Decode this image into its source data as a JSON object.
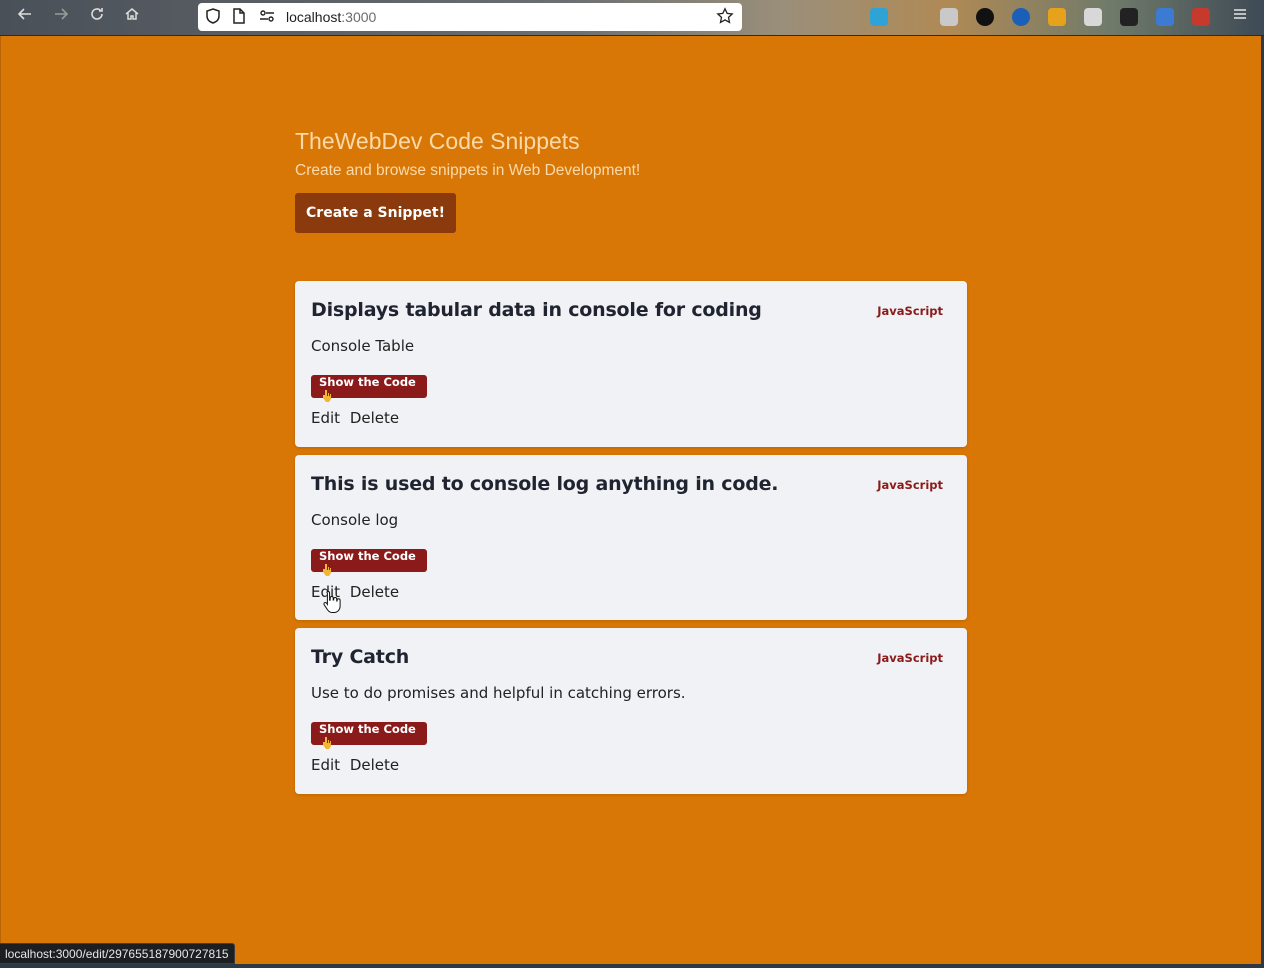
{
  "browser": {
    "url_host": "localhost",
    "url_port": ":3000",
    "status_url": "localhost:3000/edit/297655187900727815"
  },
  "page": {
    "title": "TheWebDev Code Snippets",
    "subtitle": "Create and browse snippets in Web Development!",
    "create_button": "Create a Snippet!"
  },
  "snippets": [
    {
      "title": "Displays tabular data in console for coding",
      "language": "JavaScript",
      "description": "Console Table",
      "show_button": "Show the Code",
      "edit": "Edit",
      "delete": "Delete"
    },
    {
      "title": "This is used to console log anything in code.",
      "language": "JavaScript",
      "description": "Console log",
      "show_button": "Show the Code",
      "edit": "Edit",
      "delete": "Delete"
    },
    {
      "title": "Try Catch",
      "language": "JavaScript",
      "description": "Use to do promises and helpful in catching errors.",
      "show_button": "Show the Code",
      "edit": "Edit",
      "delete": "Delete"
    }
  ],
  "colors": {
    "background": "#d97706",
    "primary_button": "#8a3a0c",
    "accent": "#8b1a1a",
    "card": "#f0f2f5"
  },
  "icons": [
    "back-icon",
    "forward-icon",
    "reload-icon",
    "home-icon",
    "shield-icon",
    "page-icon",
    "site-settings-icon",
    "bookmark-star-icon",
    "pointing-down-hand-icon",
    "menu-icon"
  ]
}
